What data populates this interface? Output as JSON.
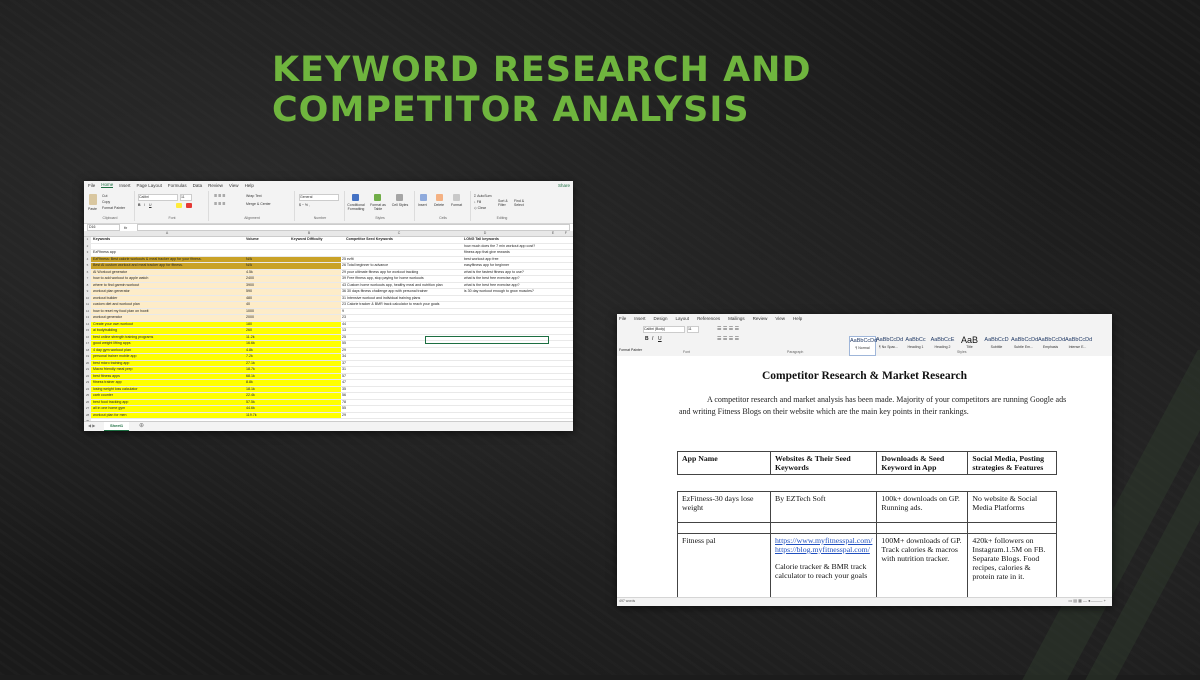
{
  "headline": {
    "line1": "KEYWORD RESEARCH AND",
    "line2": "COMPETITOR ANALYSIS"
  },
  "colors": {
    "accent_green": "#6fb53e",
    "excel_green": "#1d6f42",
    "highlight_yellow": "#ffff00",
    "highlight_gold": "#c9a227"
  },
  "excel": {
    "menu": [
      "File",
      "Home",
      "Insert",
      "Page Layout",
      "Formulas",
      "Data",
      "Review",
      "View",
      "Help"
    ],
    "active_menu": "Home",
    "share_label": "Share",
    "ribbon": {
      "paste": "Paste",
      "cut": "Cut",
      "copy": "Copy",
      "format_painter": "Format Painter",
      "clipboard": "Clipboard",
      "font_name": "Calibri",
      "font_size": "11",
      "font": "Font",
      "wrap_text": "Wrap Text",
      "merge_center": "Merge & Center",
      "alignment": "Alignment",
      "number_format": "General",
      "number": "Number",
      "conditional": "Conditional Formatting",
      "format_table": "Format as Table",
      "cell_styles": "Cell Styles",
      "styles": "Styles",
      "insert": "Insert",
      "delete": "Delete",
      "format": "Format",
      "cells": "Cells",
      "autosum": "AutoSum",
      "fill": "Fill",
      "clear": "Clear",
      "sort_filter": "Sort & Filter",
      "find_select": "Find & Select",
      "editing": "Editing"
    },
    "name_box": "D16",
    "columns": [
      "A",
      "B",
      "C",
      "D",
      "E",
      "F",
      "G"
    ],
    "headers": {
      "keywords": "Keywords",
      "volume": "Volume",
      "difficulty": "Keyword Difficulty",
      "seed": "Competitor Seed Keywords",
      "long_tail": "LONG Tail keywords"
    },
    "rows": [
      {
        "n": "2",
        "a": "",
        "b": "",
        "c": "",
        "d": "",
        "e": "how much does the 7 min workout app cost?"
      },
      {
        "n": "3",
        "a": "EzFitness app",
        "b": "",
        "c": "",
        "d": "",
        "e": "fitness app that give rewards"
      },
      {
        "n": "4",
        "a": "EzFitness: Best calorie workouts & meal tracker app for your fitness.",
        "b": "N/A",
        "c": "",
        "d": "25  ezfit",
        "e": "best workout app free"
      },
      {
        "n": "5",
        "a": "Best AI custom workout and meal tracker app for fitness.",
        "b": "N/A",
        "c": "",
        "d": "26  Total beginner to advance",
        "e": "easyfitness app for beginner"
      },
      {
        "n": "6",
        "a": "AI Workout generator",
        "b": "4.5k",
        "c": "",
        "d": "29  your ultimate fitness app for workout tracking",
        "e": "what is the fastest fitness app to use?"
      },
      {
        "n": "7",
        "a": "how to add workout to apple watch",
        "b": "2400",
        "c": "",
        "d": "39  Free fitness app, stop paying for home workouts",
        "e": "what is the best free exercise app?"
      },
      {
        "n": "8",
        "a": "where to find garmin workout",
        "b": "3900",
        "c": "",
        "d": "43  Custom home workouts app, healthy meal and nutrition plan",
        "e": "what is the best free exercise app?"
      },
      {
        "n": "9",
        "a": "workout plan generator",
        "b": "590",
        "c": "",
        "d": "36  30 days fitness challenge app with personal trainer",
        "e": "is 30 day workout enough to grow muscles?"
      },
      {
        "n": "10",
        "a": "workout builder",
        "b": "480",
        "c": "",
        "d": "31  Intensive workout and individual training plans",
        "e": ""
      },
      {
        "n": "11",
        "a": "custom diet and workout plan",
        "b": "40",
        "c": "",
        "d": "23  Calorie tracker & BMR track calculator to reach your goals",
        "e": ""
      },
      {
        "n": "12",
        "a": "how to reset my food plan on howit",
        "b": "1000",
        "c": "",
        "d": "9",
        "e": ""
      },
      {
        "n": "13",
        "a": "workout generator",
        "b": "2000",
        "c": "",
        "d": "23",
        "e": ""
      },
      {
        "n": "14",
        "a": "Create your own workout",
        "b": "180",
        "c": "",
        "d": "44",
        "e": ""
      },
      {
        "n": "15",
        "a": "ai bodybuilding",
        "b": "260",
        "c": "",
        "d": "13",
        "e": ""
      },
      {
        "n": "16",
        "a": "best online strength training programs",
        "b": "11.2k",
        "c": "",
        "d": "25",
        "e": ""
      },
      {
        "n": "17",
        "a": "good weight lifting apps",
        "b": "16.6k",
        "c": "",
        "d": "55",
        "e": ""
      },
      {
        "n": "18",
        "a": "4 day gym workout plan",
        "b": "4.8k",
        "c": "",
        "d": "29",
        "e": ""
      },
      {
        "n": "19",
        "a": "personal trainer mobile app",
        "b": "7.2k",
        "c": "",
        "d": "34",
        "e": ""
      },
      {
        "n": "20",
        "a": "best micro training app",
        "b": "27.1k",
        "c": "",
        "d": "37",
        "e": ""
      },
      {
        "n": "21",
        "a": "Macro friendly meal prep",
        "b": "18.7k",
        "c": "",
        "d": "31",
        "e": ""
      },
      {
        "n": "22",
        "a": "best fitness apps",
        "b": "68.1k",
        "c": "",
        "d": "57",
        "e": ""
      },
      {
        "n": "23",
        "a": "fitness trainer app",
        "b": "8.8k",
        "c": "",
        "d": "47",
        "e": ""
      },
      {
        "n": "24",
        "a": "losing weight loss calculator",
        "b": "18.1k",
        "c": "",
        "d": "35",
        "e": ""
      },
      {
        "n": "25",
        "a": "carb counter",
        "b": "22.4k",
        "c": "",
        "d": "56",
        "e": ""
      },
      {
        "n": "26",
        "a": "best food tracking app",
        "b": "57.5k",
        "c": "",
        "d": "78",
        "e": ""
      },
      {
        "n": "27",
        "a": "all in one home gym",
        "b": "44.6k",
        "c": "",
        "d": "55",
        "e": ""
      },
      {
        "n": "28",
        "a": "workout plan for men",
        "b": "119.7k",
        "c": "",
        "d": "29",
        "e": ""
      },
      {
        "n": "29",
        "a": "",
        "b": "",
        "c": "",
        "d": "",
        "e": ""
      }
    ],
    "sheet_tab": "Sheet1"
  },
  "word": {
    "menu": [
      "File",
      "Insert",
      "Design",
      "Layout",
      "References",
      "Mailings",
      "Review",
      "View",
      "Help"
    ],
    "font_name": "Calibri (Body)",
    "font_size": "11",
    "styles": [
      {
        "sample": "AaBbCcDd",
        "name": "¶ Normal"
      },
      {
        "sample": "AaBbCcDd",
        "name": "¶ No Spac..."
      },
      {
        "sample": "AaBbCc",
        "name": "Heading 1"
      },
      {
        "sample": "AaBbCcE",
        "name": "Heading 2"
      },
      {
        "sample": "AaB",
        "name": "Title"
      },
      {
        "sample": "AaBbCcD",
        "name": "Subtitle"
      },
      {
        "sample": "AaBbCcDd",
        "name": "Subtle Em..."
      },
      {
        "sample": "AaBbCcDd",
        "name": "Emphasis"
      },
      {
        "sample": "AaBbCcDd",
        "name": "Intense E..."
      }
    ],
    "group_labels": {
      "clipboard": "Clipboard",
      "font": "Font",
      "paragraph": "Paragraph",
      "styles": "Styles"
    },
    "paste": "Paste",
    "format_painter": "Format Painter",
    "title": "Competitor Research & Market Research",
    "paragraph": "A competitor research and market analysis has been made. Majority of your competitors are running Google ads and writing Fitness Blogs on their website which are the main key points in their rankings.",
    "table": {
      "headers": [
        "App Name",
        "Websites & Their Seed Keywords",
        "Downloads & Seed Keyword in App",
        "Social Media, Posting strategies & Features"
      ],
      "row1": {
        "app": "EzFitness-30 days lose weight",
        "site": "By EZTech Soft",
        "downloads": "100k+ downloads on GP. Running ads.",
        "social": "No website & Social Media Platforms"
      },
      "row2": {
        "app": "Fitness pal",
        "link1": "https://www.myfitnesspal.com/",
        "link2": "https://blog.myfitnesspal.com/",
        "site_note": "Calorie tracker & BMR track calculator to reach your goals",
        "downloads": "100M+ downloads of GP. Track calories & macros with nutrition tracker.",
        "social": "420k+ followers on Instagram.1.5M on FB. Separate Blogs. Food recipes, calories & protein rate in it."
      }
    },
    "status_words": "497 words"
  }
}
